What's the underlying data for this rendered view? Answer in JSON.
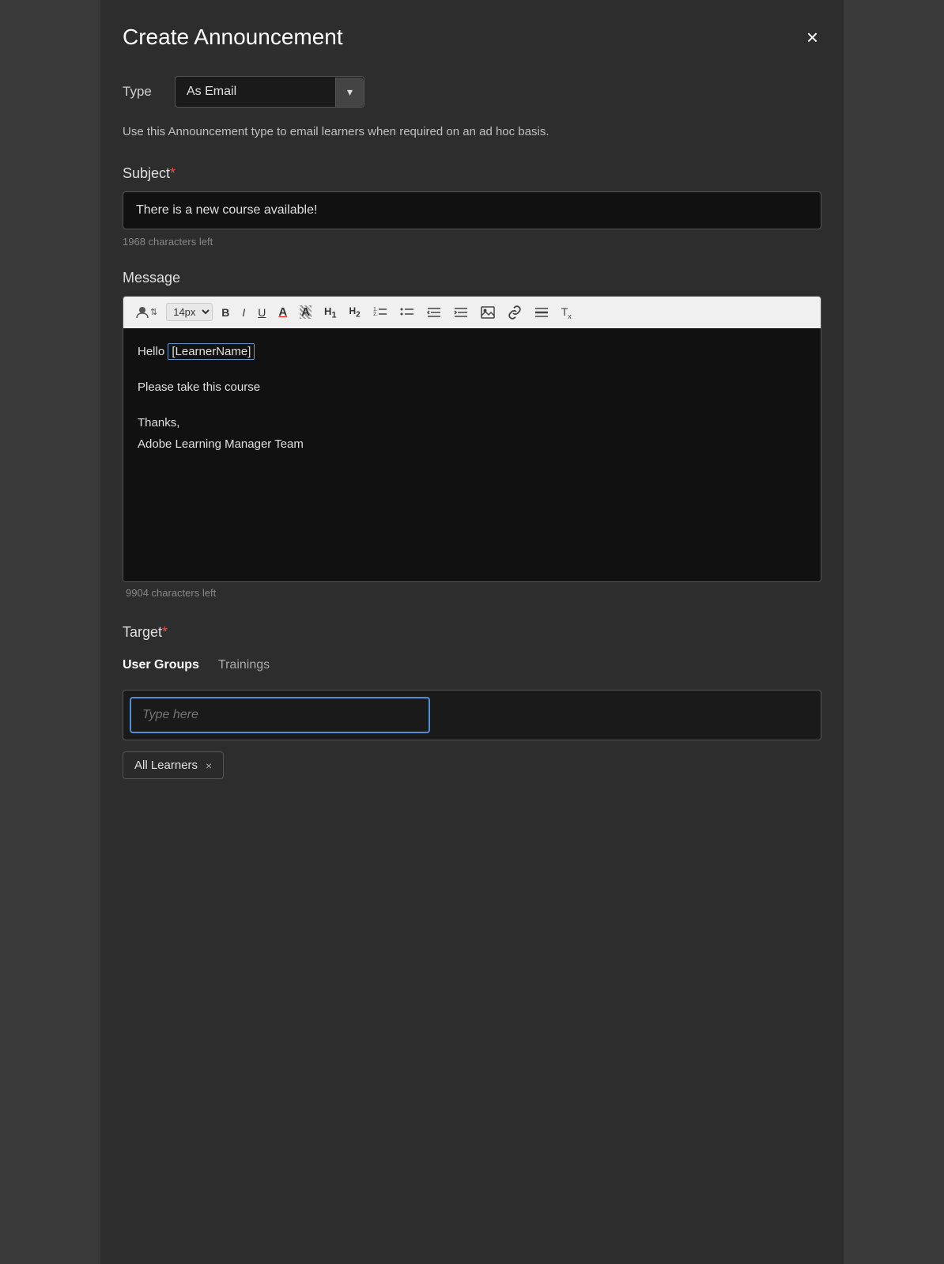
{
  "modal": {
    "title": "Create Announcement",
    "close_label": "×"
  },
  "type_field": {
    "label": "Type",
    "value": "As Email",
    "arrow": "▾"
  },
  "description": "Use this Announcement type to email learners when required on an ad hoc basis.",
  "subject": {
    "label": "Subject",
    "required": "*",
    "value": "There is a new course available!",
    "chars_left": "1968 characters left"
  },
  "message": {
    "label": "Message",
    "chars_left": "9904 characters left",
    "content_line1_prefix": "Hello ",
    "content_learner_tag": "[LearnerName]",
    "content_line2": "Please take this course",
    "content_line3a": "Thanks,",
    "content_line3b": "Adobe Learning Manager Team"
  },
  "toolbar": {
    "font_size": "14px",
    "bold": "B",
    "italic": "I",
    "underline": "U",
    "color_a": "A",
    "highlight": "A",
    "h1": "H1",
    "h2": "H2",
    "ordered_list": "≡",
    "unordered_list": "≡",
    "indent_left": "⇤",
    "indent_right": "⇥",
    "image": "🖼",
    "link": "🔗",
    "hr": "—",
    "clear_format": "Tx"
  },
  "target": {
    "label": "Target",
    "required": "*"
  },
  "tabs": [
    {
      "label": "User Groups",
      "active": true
    },
    {
      "label": "Trainings",
      "active": false
    }
  ],
  "type_here_placeholder": "Type here",
  "all_learners_tag": {
    "label": "All Learners",
    "close": "×"
  }
}
